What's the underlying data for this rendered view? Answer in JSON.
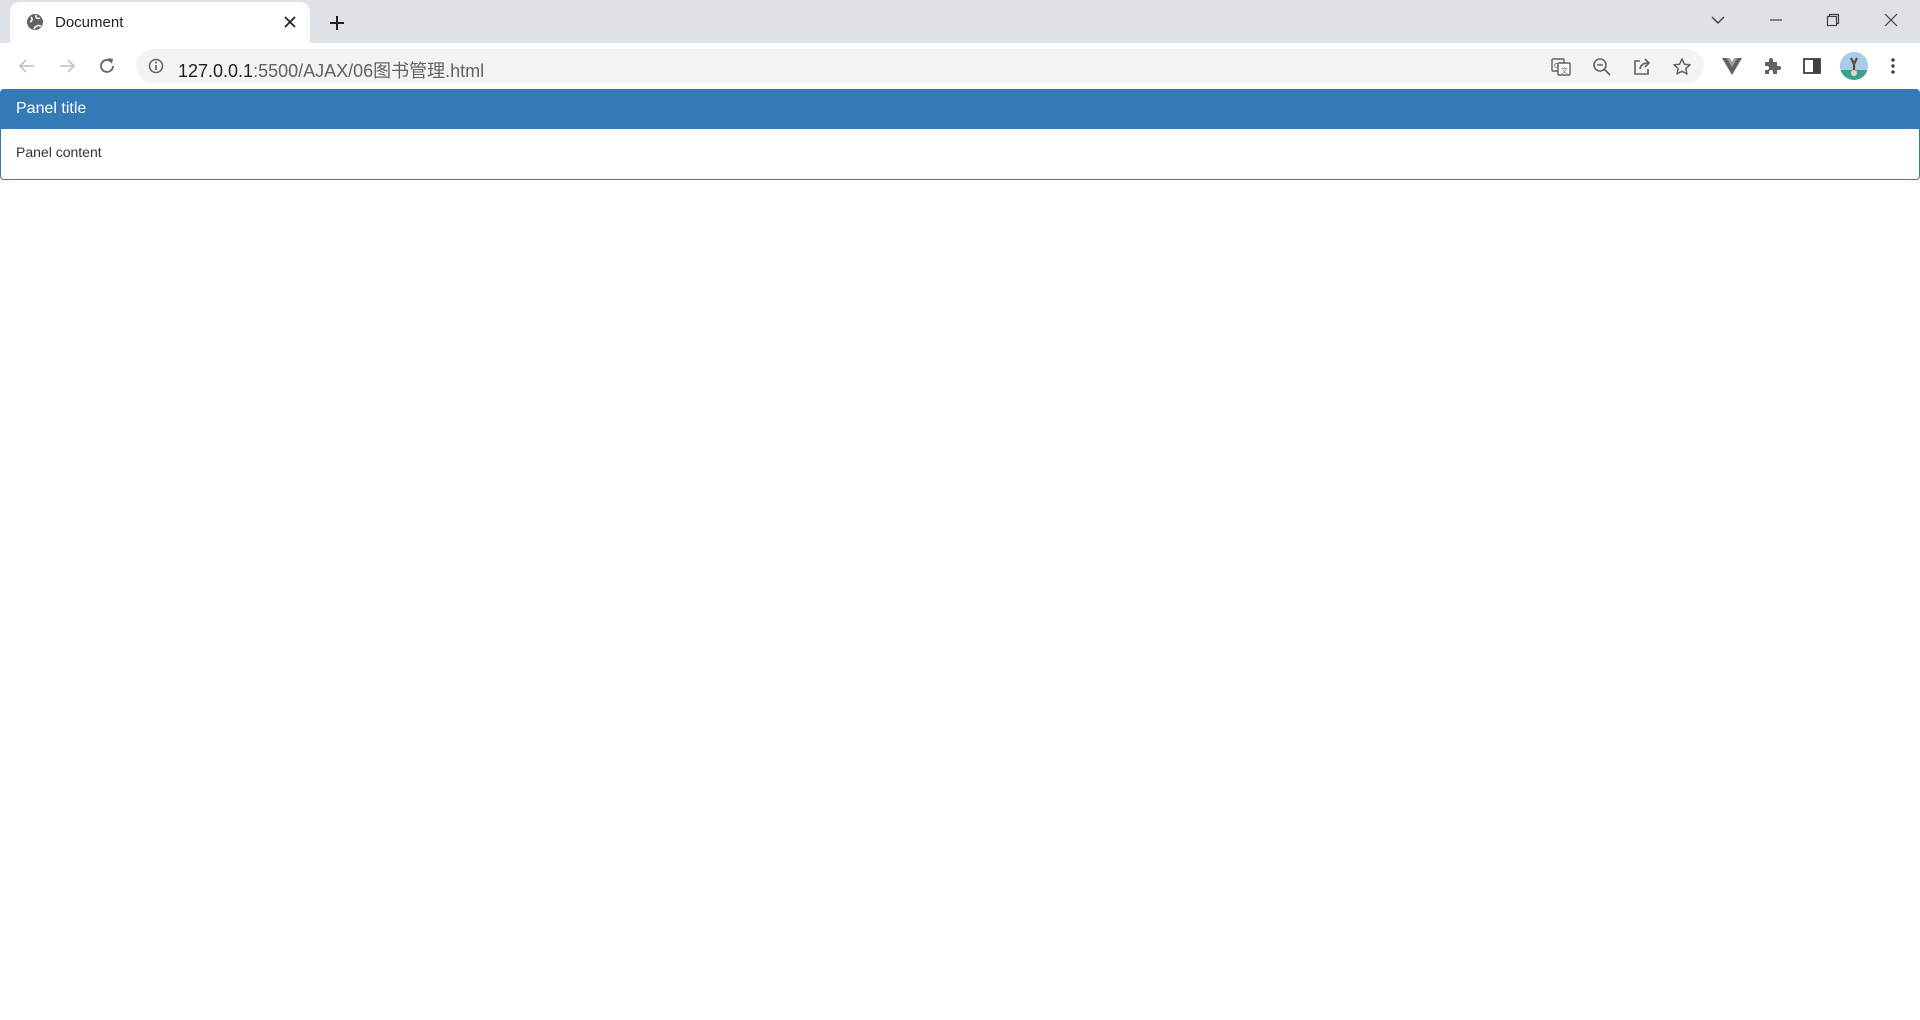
{
  "browser": {
    "tab": {
      "title": "Document"
    },
    "address": {
      "host": "127.0.0.1",
      "rest": ":5500/AJAX/06图书管理.html"
    }
  },
  "page": {
    "panel": {
      "title": "Panel title",
      "content": "Panel content"
    }
  },
  "colors": {
    "panel_primary": "#337ab7",
    "chrome_frame": "#dee1e6",
    "omnibox_bg": "#f1f3f4"
  },
  "icons": {
    "tab_favicon": "globe-icon",
    "tab_close": "close-icon",
    "new_tab": "plus-icon",
    "tab_search": "chevron-down-icon",
    "minimize": "minimize-icon",
    "restore": "restore-icon",
    "close_window": "close-window-icon",
    "back": "arrow-left-icon",
    "forward": "arrow-right-icon",
    "reload": "reload-icon",
    "site_info": "info-icon",
    "translate": "translate-icon",
    "zoom": "zoom-out-icon",
    "share": "share-icon",
    "bookmark": "star-icon",
    "vue_devtools": "vue-icon",
    "extensions": "puzzle-icon",
    "side_panel": "side-panel-icon",
    "profile": "avatar",
    "menu": "kebab-menu-icon"
  }
}
